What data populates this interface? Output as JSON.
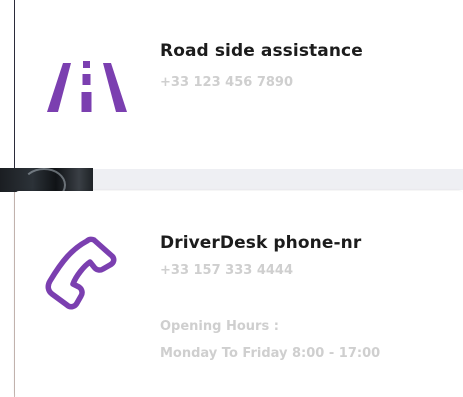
{
  "colors": {
    "accent": "#7b3fb0",
    "title": "#1c1c1c",
    "muted": "#cfcfcf"
  },
  "contacts": [
    {
      "icon": "road-icon",
      "title": "Road side assistance",
      "phone": "+33 123 456 7890"
    },
    {
      "icon": "phone-icon",
      "title": "DriverDesk phone-nr",
      "phone": "+33 157 333 4444",
      "hours_label": "Opening Hours :",
      "hours": "Monday To Friday 8:00 - 17:00"
    }
  ]
}
